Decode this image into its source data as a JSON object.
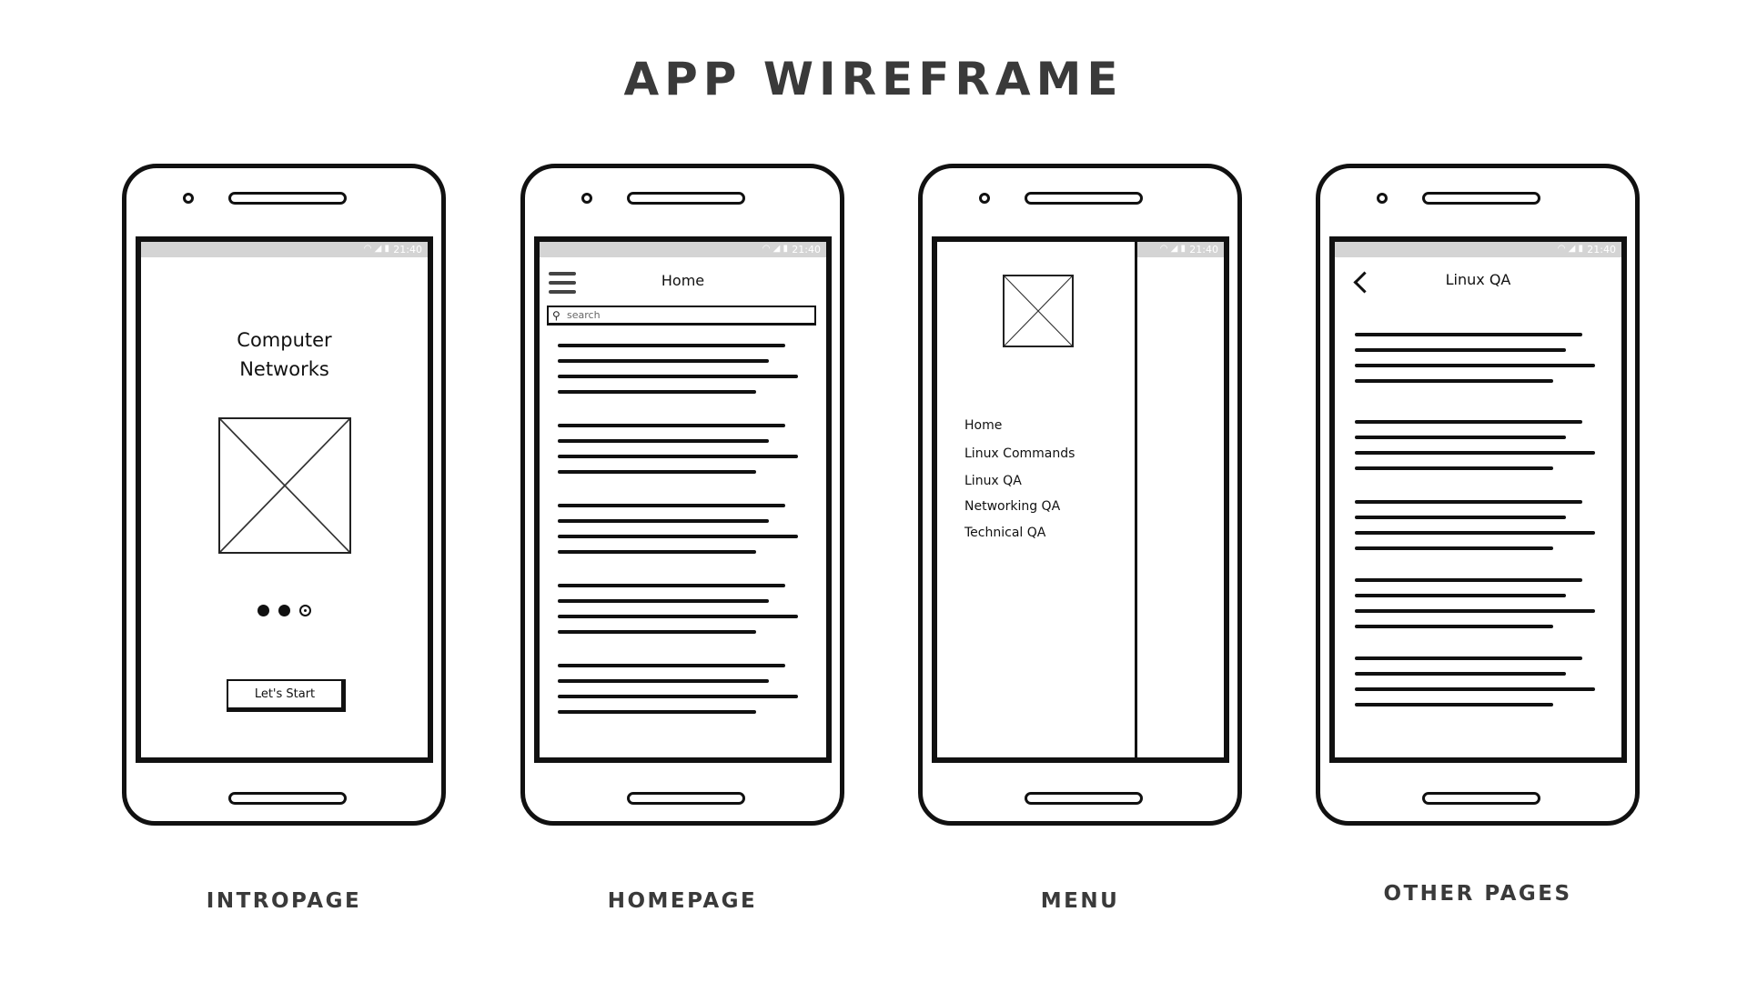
{
  "title": "APP WIREFRAME",
  "status_time": "21:40",
  "screens": [
    {
      "caption": "INTROPAGE"
    },
    {
      "caption": "HOMEPAGE"
    },
    {
      "caption": "MENU"
    },
    {
      "caption": "OTHER PAGES"
    }
  ],
  "intro": {
    "title_line1": "Computer",
    "title_line2": "Networks",
    "carousel_pages": 3,
    "carousel_active": 3,
    "start_button": "Let's Start"
  },
  "home": {
    "header_title": "Home",
    "search_placeholder": "search",
    "icons": [
      "hamburger-menu-icon",
      "search-icon"
    ]
  },
  "menu": {
    "items": [
      "Home",
      "Linux Commands",
      "Linux QA",
      "Networking QA",
      "Technical QA"
    ]
  },
  "other": {
    "header_title": "Linux QA",
    "icons": [
      "back-arrow-icon"
    ]
  }
}
